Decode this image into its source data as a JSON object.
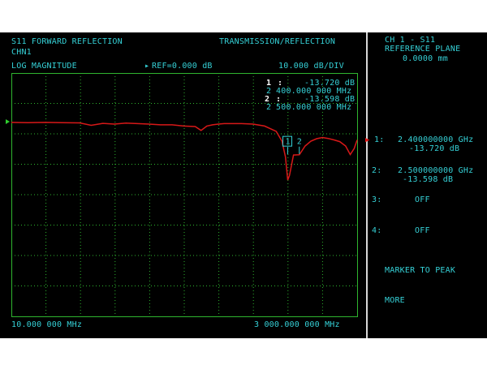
{
  "header": {
    "measurement": "S11 FORWARD REFLECTION",
    "mode": "TRANSMISSION/REFLECTION",
    "channel": "CHN1",
    "format": "LOG MAGNITUDE",
    "ref_arrow": "▸",
    "ref_label": "REF=0.000 dB",
    "scale": "10.000 dB/DIV"
  },
  "marker_readout": [
    {
      "num": "1",
      "sep": ":",
      "value": "-13.720 dB",
      "freq_num": "2",
      "freq": "400.000 000 MHz"
    },
    {
      "num": "2",
      "sep": ":",
      "value": "-13.598 dB",
      "freq_num": "2",
      "freq": "500.000 000 MHz"
    }
  ],
  "footer": {
    "start_freq": "10.000 000 MHz",
    "stop_freq": "3 000.000 000 MHz"
  },
  "side_panel": {
    "title": "CH 1 - S11",
    "subtitle": "REFERENCE PLANE",
    "ref_plane_value": "0.0000 mm",
    "active_arrow": "▶",
    "markers": [
      {
        "label": "1:",
        "freq": "2.400000000 GHz",
        "value": "-13.720 dB"
      },
      {
        "label": "2:",
        "freq": "2.500000000 GHz",
        "value": "-13.598 dB"
      },
      {
        "label": "3:",
        "freq": "OFF",
        "value": ""
      },
      {
        "label": "4:",
        "freq": "OFF",
        "value": ""
      }
    ],
    "actions": [
      "MARKER TO PEAK",
      "MORE"
    ]
  },
  "plot_markers": [
    {
      "label": "1"
    },
    {
      "label": "2"
    }
  ],
  "chart_data": {
    "type": "line",
    "x_unit": "MHz",
    "y_unit": "dB",
    "xlim": [
      10,
      3000
    ],
    "ylim": [
      -80,
      20
    ],
    "grid": true,
    "reference_level": 0,
    "series": [
      {
        "color": "#d81818",
        "x": [
          10,
          150,
          300,
          450,
          600,
          700,
          800,
          900,
          1000,
          1100,
          1200,
          1300,
          1400,
          1500,
          1600,
          1650,
          1700,
          1750,
          1800,
          1850,
          2000,
          2100,
          2200,
          2300,
          2350,
          2380,
          2400,
          2415,
          2450,
          2500,
          2550,
          2600,
          2650,
          2700,
          2750,
          2800,
          2850,
          2900,
          2940,
          2975,
          3000
        ],
        "y": [
          -0.3,
          -0.4,
          -0.3,
          -0.4,
          -0.5,
          -1.5,
          -0.7,
          -1.0,
          -0.6,
          -0.8,
          -1.0,
          -1.3,
          -1.3,
          -1.8,
          -2.0,
          -3.6,
          -1.8,
          -1.3,
          -1.0,
          -0.8,
          -0.8,
          -1.0,
          -1.8,
          -4.0,
          -8.0,
          -14.5,
          -24.0,
          -22.0,
          -13.7,
          -13.6,
          -10.0,
          -8.0,
          -7.0,
          -6.5,
          -6.9,
          -7.5,
          -8.2,
          -10.0,
          -13.5,
          -11.0,
          -7.5
        ]
      }
    ],
    "markers": [
      {
        "label": "1",
        "x": 2400,
        "y": -13.72
      },
      {
        "label": "2",
        "x": 2500,
        "y": -13.598
      }
    ]
  }
}
